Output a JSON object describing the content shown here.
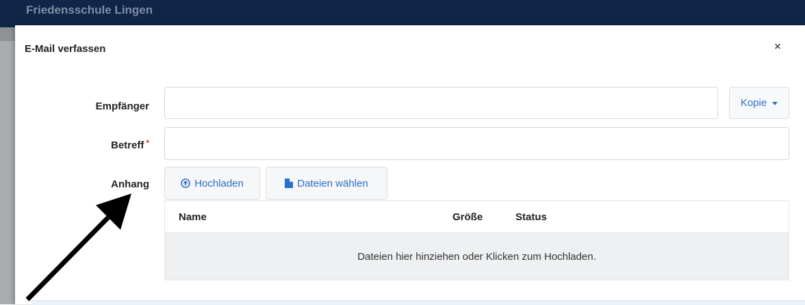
{
  "app": {
    "brand": "Friedensschule Lingen"
  },
  "modal": {
    "title": "E-Mail verfassen",
    "close_label": "×"
  },
  "form": {
    "recipient": {
      "label": "Empfänger",
      "value": "",
      "copy_button_label": "Kopie"
    },
    "subject": {
      "label": "Betreff",
      "required_mark": "*",
      "value": ""
    },
    "attachment": {
      "label": "Anhang",
      "upload_button_label": "Hochladen",
      "choose_files_button_label": "Dateien wählen",
      "table": {
        "columns": [
          "Name",
          "Größe",
          "Status"
        ],
        "dropzone_text": "Dateien hier hinziehen oder Klicken zum Hochladen."
      }
    }
  },
  "icons": {
    "upload": "circle-arrow-up-icon",
    "file": "file-icon",
    "caret": "caret-down-icon",
    "annotation_arrow": "arrow-icon"
  },
  "colors": {
    "topbar": "#0f2647",
    "link_blue": "#2a6fc9",
    "required_red": "#d0342c",
    "dropzone_bg": "#eef0f2"
  }
}
